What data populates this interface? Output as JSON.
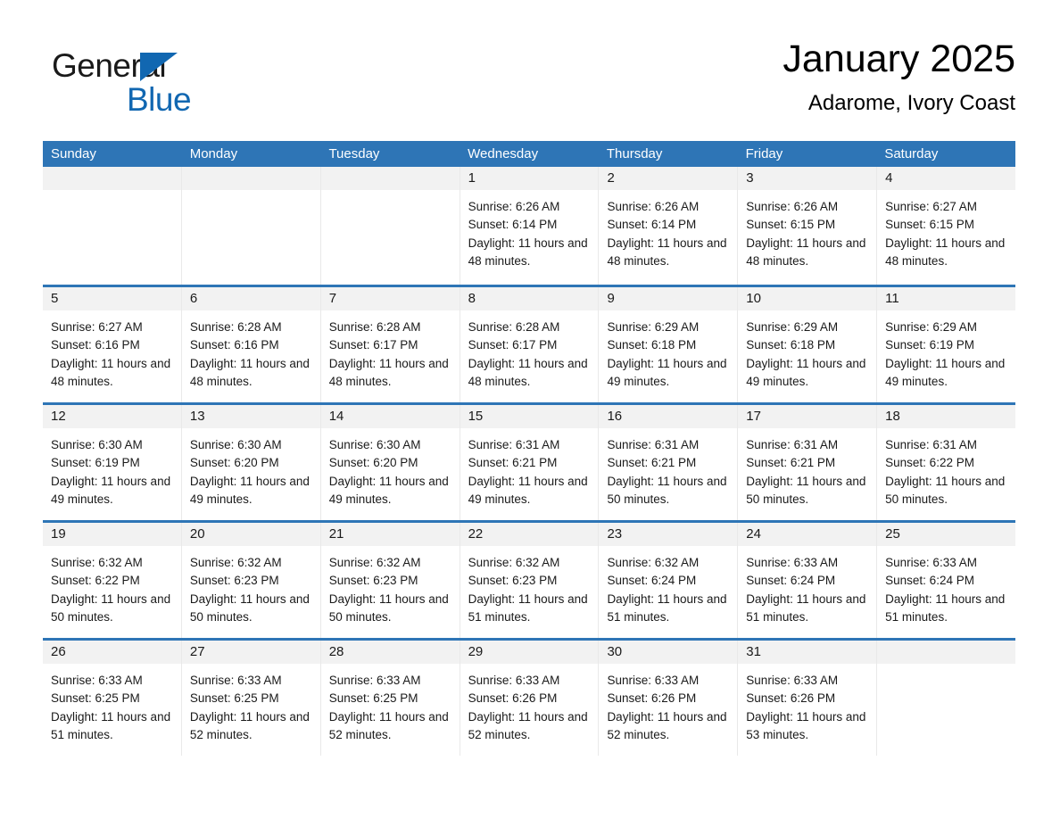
{
  "brand": {
    "name_part1": "General",
    "name_part2": "Blue",
    "triangle_color": "#1167b1",
    "blue_color": "#1167b1"
  },
  "header": {
    "title": "January 2025",
    "subtitle": "Adarome, Ivory Coast"
  },
  "theme": {
    "header_blue": "#2e75b6",
    "daynum_band": "#f2f2f2",
    "text": "#1a1a1a"
  },
  "weekdays": [
    "Sunday",
    "Monday",
    "Tuesday",
    "Wednesday",
    "Thursday",
    "Friday",
    "Saturday"
  ],
  "weeks": [
    [
      {
        "day": "",
        "sunrise": "",
        "sunset": "",
        "daylight": "",
        "empty": true
      },
      {
        "day": "",
        "sunrise": "",
        "sunset": "",
        "daylight": "",
        "empty": true
      },
      {
        "day": "",
        "sunrise": "",
        "sunset": "",
        "daylight": "",
        "empty": true
      },
      {
        "day": "1",
        "sunrise": "Sunrise: 6:26 AM",
        "sunset": "Sunset: 6:14 PM",
        "daylight": "Daylight: 11 hours and 48 minutes."
      },
      {
        "day": "2",
        "sunrise": "Sunrise: 6:26 AM",
        "sunset": "Sunset: 6:14 PM",
        "daylight": "Daylight: 11 hours and 48 minutes."
      },
      {
        "day": "3",
        "sunrise": "Sunrise: 6:26 AM",
        "sunset": "Sunset: 6:15 PM",
        "daylight": "Daylight: 11 hours and 48 minutes."
      },
      {
        "day": "4",
        "sunrise": "Sunrise: 6:27 AM",
        "sunset": "Sunset: 6:15 PM",
        "daylight": "Daylight: 11 hours and 48 minutes."
      }
    ],
    [
      {
        "day": "5",
        "sunrise": "Sunrise: 6:27 AM",
        "sunset": "Sunset: 6:16 PM",
        "daylight": "Daylight: 11 hours and 48 minutes."
      },
      {
        "day": "6",
        "sunrise": "Sunrise: 6:28 AM",
        "sunset": "Sunset: 6:16 PM",
        "daylight": "Daylight: 11 hours and 48 minutes."
      },
      {
        "day": "7",
        "sunrise": "Sunrise: 6:28 AM",
        "sunset": "Sunset: 6:17 PM",
        "daylight": "Daylight: 11 hours and 48 minutes."
      },
      {
        "day": "8",
        "sunrise": "Sunrise: 6:28 AM",
        "sunset": "Sunset: 6:17 PM",
        "daylight": "Daylight: 11 hours and 48 minutes."
      },
      {
        "day": "9",
        "sunrise": "Sunrise: 6:29 AM",
        "sunset": "Sunset: 6:18 PM",
        "daylight": "Daylight: 11 hours and 49 minutes."
      },
      {
        "day": "10",
        "sunrise": "Sunrise: 6:29 AM",
        "sunset": "Sunset: 6:18 PM",
        "daylight": "Daylight: 11 hours and 49 minutes."
      },
      {
        "day": "11",
        "sunrise": "Sunrise: 6:29 AM",
        "sunset": "Sunset: 6:19 PM",
        "daylight": "Daylight: 11 hours and 49 minutes."
      }
    ],
    [
      {
        "day": "12",
        "sunrise": "Sunrise: 6:30 AM",
        "sunset": "Sunset: 6:19 PM",
        "daylight": "Daylight: 11 hours and 49 minutes."
      },
      {
        "day": "13",
        "sunrise": "Sunrise: 6:30 AM",
        "sunset": "Sunset: 6:20 PM",
        "daylight": "Daylight: 11 hours and 49 minutes."
      },
      {
        "day": "14",
        "sunrise": "Sunrise: 6:30 AM",
        "sunset": "Sunset: 6:20 PM",
        "daylight": "Daylight: 11 hours and 49 minutes."
      },
      {
        "day": "15",
        "sunrise": "Sunrise: 6:31 AM",
        "sunset": "Sunset: 6:21 PM",
        "daylight": "Daylight: 11 hours and 49 minutes."
      },
      {
        "day": "16",
        "sunrise": "Sunrise: 6:31 AM",
        "sunset": "Sunset: 6:21 PM",
        "daylight": "Daylight: 11 hours and 50 minutes."
      },
      {
        "day": "17",
        "sunrise": "Sunrise: 6:31 AM",
        "sunset": "Sunset: 6:21 PM",
        "daylight": "Daylight: 11 hours and 50 minutes."
      },
      {
        "day": "18",
        "sunrise": "Sunrise: 6:31 AM",
        "sunset": "Sunset: 6:22 PM",
        "daylight": "Daylight: 11 hours and 50 minutes."
      }
    ],
    [
      {
        "day": "19",
        "sunrise": "Sunrise: 6:32 AM",
        "sunset": "Sunset: 6:22 PM",
        "daylight": "Daylight: 11 hours and 50 minutes."
      },
      {
        "day": "20",
        "sunrise": "Sunrise: 6:32 AM",
        "sunset": "Sunset: 6:23 PM",
        "daylight": "Daylight: 11 hours and 50 minutes."
      },
      {
        "day": "21",
        "sunrise": "Sunrise: 6:32 AM",
        "sunset": "Sunset: 6:23 PM",
        "daylight": "Daylight: 11 hours and 50 minutes."
      },
      {
        "day": "22",
        "sunrise": "Sunrise: 6:32 AM",
        "sunset": "Sunset: 6:23 PM",
        "daylight": "Daylight: 11 hours and 51 minutes."
      },
      {
        "day": "23",
        "sunrise": "Sunrise: 6:32 AM",
        "sunset": "Sunset: 6:24 PM",
        "daylight": "Daylight: 11 hours and 51 minutes."
      },
      {
        "day": "24",
        "sunrise": "Sunrise: 6:33 AM",
        "sunset": "Sunset: 6:24 PM",
        "daylight": "Daylight: 11 hours and 51 minutes."
      },
      {
        "day": "25",
        "sunrise": "Sunrise: 6:33 AM",
        "sunset": "Sunset: 6:24 PM",
        "daylight": "Daylight: 11 hours and 51 minutes."
      }
    ],
    [
      {
        "day": "26",
        "sunrise": "Sunrise: 6:33 AM",
        "sunset": "Sunset: 6:25 PM",
        "daylight": "Daylight: 11 hours and 51 minutes."
      },
      {
        "day": "27",
        "sunrise": "Sunrise: 6:33 AM",
        "sunset": "Sunset: 6:25 PM",
        "daylight": "Daylight: 11 hours and 52 minutes."
      },
      {
        "day": "28",
        "sunrise": "Sunrise: 6:33 AM",
        "sunset": "Sunset: 6:25 PM",
        "daylight": "Daylight: 11 hours and 52 minutes."
      },
      {
        "day": "29",
        "sunrise": "Sunrise: 6:33 AM",
        "sunset": "Sunset: 6:26 PM",
        "daylight": "Daylight: 11 hours and 52 minutes."
      },
      {
        "day": "30",
        "sunrise": "Sunrise: 6:33 AM",
        "sunset": "Sunset: 6:26 PM",
        "daylight": "Daylight: 11 hours and 52 minutes."
      },
      {
        "day": "31",
        "sunrise": "Sunrise: 6:33 AM",
        "sunset": "Sunset: 6:26 PM",
        "daylight": "Daylight: 11 hours and 53 minutes."
      },
      {
        "day": "",
        "sunrise": "",
        "sunset": "",
        "daylight": "",
        "empty": true
      }
    ]
  ]
}
